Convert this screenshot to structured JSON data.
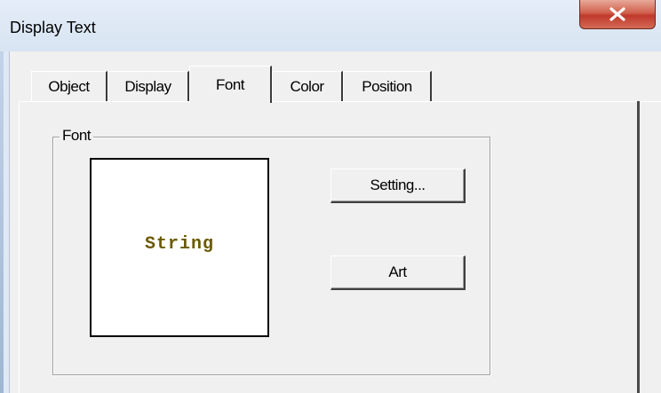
{
  "window": {
    "title": "Display Text"
  },
  "tabs": [
    {
      "label": "Object"
    },
    {
      "label": "Display"
    },
    {
      "label": "Font"
    },
    {
      "label": "Color"
    },
    {
      "label": "Position"
    }
  ],
  "active_tab": "Font",
  "font_group": {
    "label": "Font",
    "preview_text": "String",
    "preview_text_color": "#6b5a00",
    "setting_button": "Setting...",
    "art_button": "Art"
  },
  "colors": {
    "close_button": "#c0392b",
    "dialog_background": "#f0f0f0"
  }
}
